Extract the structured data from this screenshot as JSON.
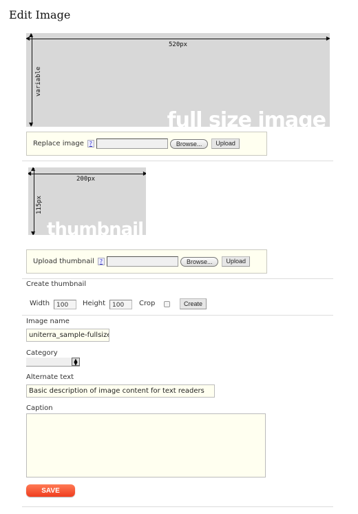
{
  "page": {
    "title": "Edit Image"
  },
  "full_image": {
    "width_label": "520px",
    "height_label": "variable",
    "watermark": "full size image"
  },
  "replace_image": {
    "label": "Replace image",
    "help": "?",
    "browse_label": "Browse...",
    "upload_label": "Upload"
  },
  "thumbnail_image": {
    "width_label": "200px",
    "height_label": "115px",
    "watermark": "thumbnail"
  },
  "upload_thumbnail": {
    "label": "Upload thumbnail",
    "help": "?",
    "browse_label": "Browse...",
    "upload_label": "Upload"
  },
  "create_thumbnail": {
    "heading": "Create thumbnail",
    "width_label": "Width",
    "width_value": "100",
    "height_label": "Height",
    "height_value": "100",
    "crop_label": "Crop",
    "crop_checked": false,
    "create_label": "Create"
  },
  "form": {
    "image_name_label": "Image name",
    "image_name_value": "uniterra_sample-fullsize",
    "category_label": "Category",
    "category_value": "",
    "alt_text_label": "Alternate text",
    "alt_text_value": "Basic description of image content for text readers",
    "caption_label": "Caption",
    "caption_value": "",
    "save_label": "SAVE"
  },
  "colors": {
    "field_background": "#fffff0",
    "save_button": "#ef3d1e",
    "placeholder_grey": "#d8d8d8"
  }
}
